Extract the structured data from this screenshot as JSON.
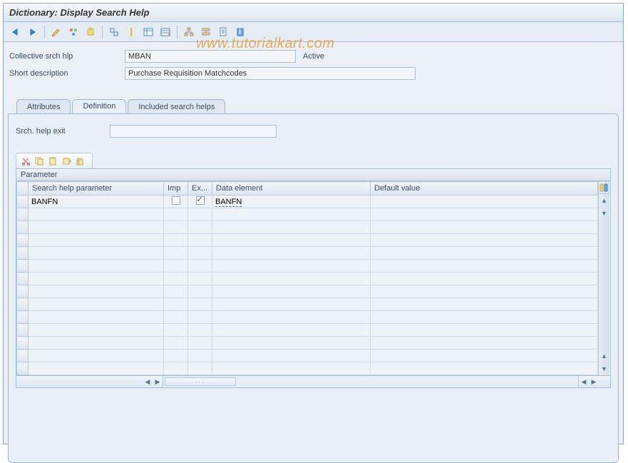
{
  "title": "Dictionary: Display Search Help",
  "watermark": "www.tutorialkart.com",
  "toolbar_icons": [
    "back",
    "forward",
    "sep",
    "pencil",
    "wand",
    "activate",
    "sep",
    "where",
    "sep",
    "table1",
    "table2",
    "sep",
    "tree",
    "hier",
    "doc",
    "info"
  ],
  "fields": {
    "coll_label": "Collective srch hlp",
    "coll_value": "MBAN",
    "status": "Active",
    "short_label": "Short description",
    "short_value": "Purchase Requisition Matchcodes"
  },
  "tabs": {
    "t1": "Attributes",
    "t2": "Definition",
    "t3": "Included search helps",
    "active": "t2"
  },
  "definition": {
    "exit_label": "Srch. help exit",
    "exit_value": ""
  },
  "grid": {
    "title": "Parameter",
    "cols": {
      "param": "Search help parameter",
      "imp": "Imp",
      "exp": "Ex...",
      "elem": "Data element",
      "default": "Default value"
    },
    "rows": [
      {
        "param": "BANFN",
        "imp": false,
        "exp": true,
        "elem": "BANFN",
        "default": ""
      },
      {
        "param": "",
        "imp": null,
        "exp": null,
        "elem": "",
        "default": ""
      },
      {
        "param": "",
        "imp": null,
        "exp": null,
        "elem": "",
        "default": ""
      },
      {
        "param": "",
        "imp": null,
        "exp": null,
        "elem": "",
        "default": ""
      },
      {
        "param": "",
        "imp": null,
        "exp": null,
        "elem": "",
        "default": ""
      },
      {
        "param": "",
        "imp": null,
        "exp": null,
        "elem": "",
        "default": ""
      },
      {
        "param": "",
        "imp": null,
        "exp": null,
        "elem": "",
        "default": ""
      },
      {
        "param": "",
        "imp": null,
        "exp": null,
        "elem": "",
        "default": ""
      },
      {
        "param": "",
        "imp": null,
        "exp": null,
        "elem": "",
        "default": ""
      },
      {
        "param": "",
        "imp": null,
        "exp": null,
        "elem": "",
        "default": ""
      },
      {
        "param": "",
        "imp": null,
        "exp": null,
        "elem": "",
        "default": ""
      },
      {
        "param": "",
        "imp": null,
        "exp": null,
        "elem": "",
        "default": ""
      },
      {
        "param": "",
        "imp": null,
        "exp": null,
        "elem": "",
        "default": ""
      },
      {
        "param": "",
        "imp": null,
        "exp": null,
        "elem": "",
        "default": ""
      }
    ]
  }
}
